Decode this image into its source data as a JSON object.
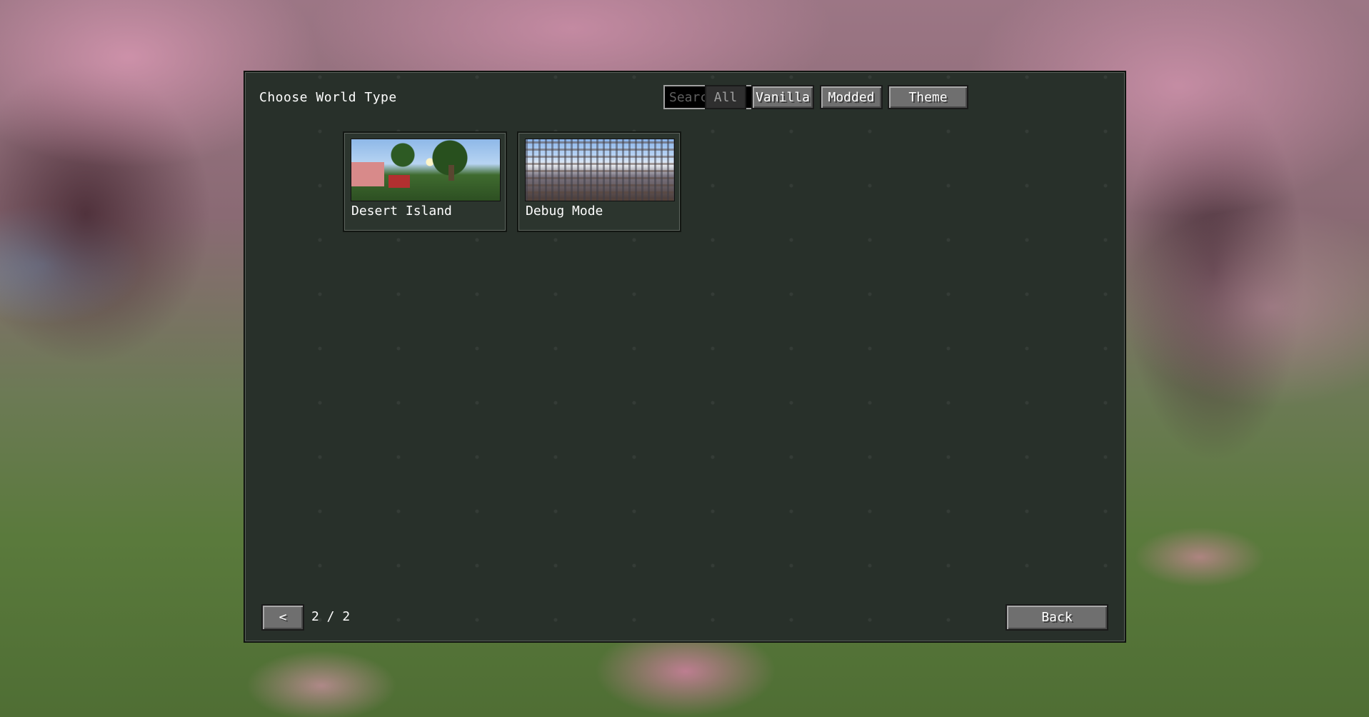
{
  "dialog": {
    "title": "Choose World Type"
  },
  "search": {
    "placeholder": "Search",
    "value": ""
  },
  "filters": [
    {
      "label": "All",
      "enabled": false
    },
    {
      "label": "Vanilla",
      "enabled": true
    },
    {
      "label": "Modded",
      "enabled": true
    },
    {
      "label": "Theme",
      "enabled": true
    }
  ],
  "world_types": [
    {
      "label": "Desert Island"
    },
    {
      "label": "Debug Mode"
    }
  ],
  "pagination": {
    "prev_icon": "chevron-left-icon",
    "prev_glyph": "<",
    "indicator": "2 / 2"
  },
  "footer": {
    "back_label": "Back"
  }
}
